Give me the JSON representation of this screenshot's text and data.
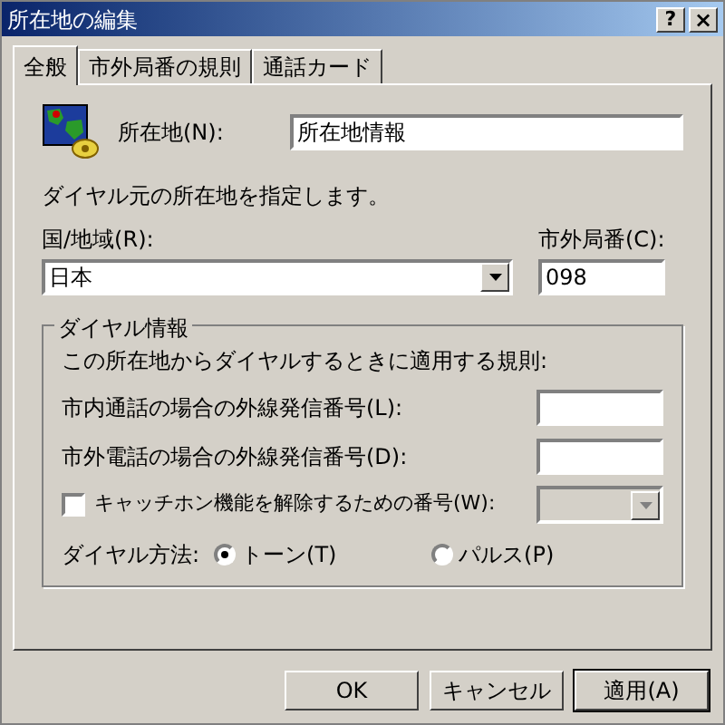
{
  "window": {
    "title": "所在地の編集",
    "help_button": "?",
    "close_button": "×"
  },
  "tabs": [
    {
      "label": "全般",
      "selected": true
    },
    {
      "label": "市外局番の規則",
      "selected": false
    },
    {
      "label": "通話カード",
      "selected": false
    }
  ],
  "location": {
    "label": "所在地(N):",
    "value": "所在地情報"
  },
  "description": "ダイヤル元の所在地を指定します。",
  "country": {
    "label": "国/地域(R):",
    "value": "日本"
  },
  "area_code": {
    "label": "市外局番(C):",
    "value": "098"
  },
  "dialing": {
    "title": "ダイヤル情報",
    "rules_text": "この所在地からダイヤルするときに適用する規則:",
    "rows": [
      {
        "kind": "field",
        "label": "市内通話の場合の外線発信番号(L):"
      },
      {
        "kind": "field",
        "label": "市外電話の場合の外線発信番号(D):"
      },
      {
        "kind": "checkbox",
        "label": "キャッチホン機能を解除するための番号(W):",
        "checked": false
      }
    ],
    "method_label": "ダイヤル方法:",
    "methods": [
      {
        "label": "トーン(T)",
        "selected": true
      },
      {
        "label": "パルス(P)",
        "selected": false
      }
    ]
  },
  "buttons": [
    {
      "label": "OK",
      "default": false
    },
    {
      "label": "キャンセル",
      "default": false
    },
    {
      "label": "適用(A)",
      "default": true
    }
  ]
}
